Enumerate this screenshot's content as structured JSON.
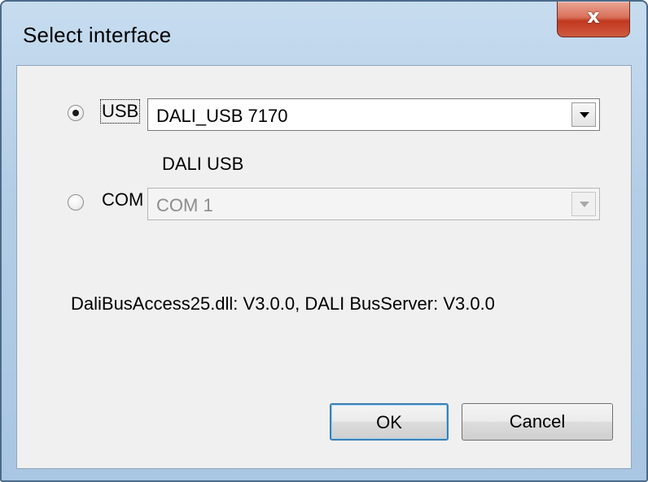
{
  "window": {
    "title": "Select interface",
    "close_glyph": "x"
  },
  "interface": {
    "usb": {
      "label": "USB",
      "selected": true,
      "device_value": "DALI_USB 7170",
      "device_name": "DALI USB"
    },
    "com": {
      "label": "COM",
      "selected": false,
      "port_value": "COM 1",
      "enabled": false
    }
  },
  "version_text": "DaliBusAccess25.dll: V3.0.0, DALI BusServer: V3.0.0",
  "buttons": {
    "ok_label": "OK",
    "cancel_label": "Cancel"
  },
  "colors": {
    "titlebar": "#b3cde6",
    "close_button": "#c2381f",
    "client_background": "#f0f0f0",
    "default_button_border": "#3c7fb1"
  },
  "icons": {
    "close": "close-icon",
    "dropdown": "chevron-down-icon"
  }
}
